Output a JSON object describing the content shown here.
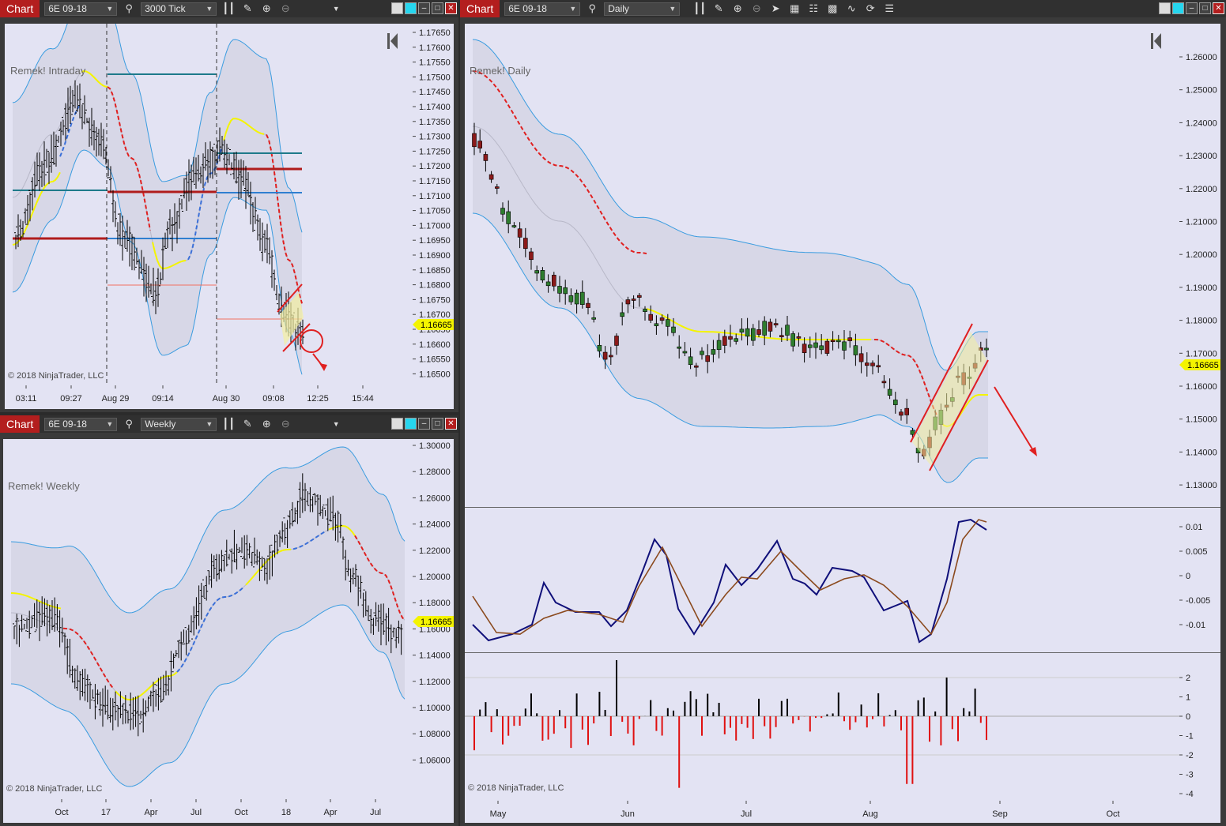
{
  "windows": {
    "intraday": {
      "tab": "Chart",
      "instrument": "6E 09-18",
      "period": "3000 Tick",
      "label": "Remek! Intraday",
      "copyright": "© 2018 NinjaTrader, LLC",
      "price_tag": "1.16665",
      "y_ticks": [
        "1.17650",
        "1.17600",
        "1.17550",
        "1.17500",
        "1.17450",
        "1.17400",
        "1.17350",
        "1.17300",
        "1.17250",
        "1.17200",
        "1.17150",
        "1.17100",
        "1.17050",
        "1.17000",
        "1.16950",
        "1.16900",
        "1.16850",
        "1.16800",
        "1.16750",
        "1.16700",
        "1.16650",
        "1.16600",
        "1.16550",
        "1.16500"
      ],
      "x_ticks": [
        "03:11",
        "09:27",
        "Aug 29",
        "09:14",
        "Aug 30",
        "09:08",
        "12:25",
        "15:44"
      ]
    },
    "weekly": {
      "tab": "Chart",
      "instrument": "6E 09-18",
      "period": "Weekly",
      "label": "Remek! Weekly",
      "copyright": "© 2018 NinjaTrader, LLC",
      "price_tag": "1.16665",
      "y_ticks": [
        "1.30000",
        "1.28000",
        "1.26000",
        "1.24000",
        "1.22000",
        "1.20000",
        "1.18000",
        "1.16000",
        "1.14000",
        "1.12000",
        "1.10000",
        "1.08000",
        "1.06000"
      ],
      "x_ticks": [
        "Oct",
        "17",
        "Apr",
        "Jul",
        "Oct",
        "18",
        "Apr",
        "Jul"
      ]
    },
    "daily": {
      "tab": "Chart",
      "instrument": "6E 09-18",
      "period": "Daily",
      "label": "Remek! Daily",
      "copyright": "© 2018 NinjaTrader, LLC",
      "price_tag": "1.16665",
      "y_ticks": [
        "1.26000",
        "1.25000",
        "1.24000",
        "1.23000",
        "1.22000",
        "1.21000",
        "1.20000",
        "1.19000",
        "1.18000",
        "1.17000",
        "1.16000",
        "1.15000",
        "1.14000",
        "1.13000"
      ],
      "osc_ticks": [
        "0.01",
        "0.005",
        "0",
        "-0.005",
        "-0.01"
      ],
      "hist_ticks": [
        "2",
        "1",
        "0",
        "-1",
        "-2",
        "-3",
        "-4"
      ],
      "x_ticks": [
        "May",
        "Jun",
        "Jul",
        "Aug",
        "Sep",
        "Oct"
      ]
    }
  },
  "colors": {
    "plot_bg": "#e3e3f3",
    "band_fill": "#d3d3e3",
    "band_line": "#3a9ce0",
    "ma_red": "#e02020",
    "ma_blue": "#3a6fd8",
    "ma_yellow": "#f4f400",
    "bull": "#2e7d2e",
    "bear": "#8b1a1a",
    "osc_fast": "#10107a",
    "osc_slow": "#8b4a1e",
    "tab_red": "#b31e1e",
    "price_tag": "#f4f400"
  },
  "icons": [
    "search-icon",
    "bars-icon",
    "pencil-icon",
    "zoom-in-icon",
    "zoom-out-icon",
    "cursor-icon",
    "data-box-icon",
    "strategy-icon",
    "indicator-icon",
    "drawing-icon",
    "reload-icon",
    "list-icon",
    "first-bar-icon"
  ]
}
